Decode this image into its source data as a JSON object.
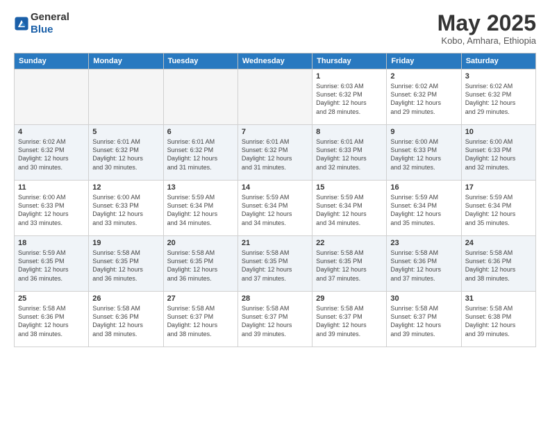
{
  "header": {
    "logo_general": "General",
    "logo_blue": "Blue",
    "month_title": "May 2025",
    "location": "Kobo, Amhara, Ethiopia"
  },
  "days_of_week": [
    "Sunday",
    "Monday",
    "Tuesday",
    "Wednesday",
    "Thursday",
    "Friday",
    "Saturday"
  ],
  "weeks": [
    [
      {
        "day": "",
        "text": ""
      },
      {
        "day": "",
        "text": ""
      },
      {
        "day": "",
        "text": ""
      },
      {
        "day": "",
        "text": ""
      },
      {
        "day": "1",
        "text": "Sunrise: 6:03 AM\nSunset: 6:32 PM\nDaylight: 12 hours\nand 28 minutes."
      },
      {
        "day": "2",
        "text": "Sunrise: 6:02 AM\nSunset: 6:32 PM\nDaylight: 12 hours\nand 29 minutes."
      },
      {
        "day": "3",
        "text": "Sunrise: 6:02 AM\nSunset: 6:32 PM\nDaylight: 12 hours\nand 29 minutes."
      }
    ],
    [
      {
        "day": "4",
        "text": "Sunrise: 6:02 AM\nSunset: 6:32 PM\nDaylight: 12 hours\nand 30 minutes."
      },
      {
        "day": "5",
        "text": "Sunrise: 6:01 AM\nSunset: 6:32 PM\nDaylight: 12 hours\nand 30 minutes."
      },
      {
        "day": "6",
        "text": "Sunrise: 6:01 AM\nSunset: 6:32 PM\nDaylight: 12 hours\nand 31 minutes."
      },
      {
        "day": "7",
        "text": "Sunrise: 6:01 AM\nSunset: 6:32 PM\nDaylight: 12 hours\nand 31 minutes."
      },
      {
        "day": "8",
        "text": "Sunrise: 6:01 AM\nSunset: 6:33 PM\nDaylight: 12 hours\nand 32 minutes."
      },
      {
        "day": "9",
        "text": "Sunrise: 6:00 AM\nSunset: 6:33 PM\nDaylight: 12 hours\nand 32 minutes."
      },
      {
        "day": "10",
        "text": "Sunrise: 6:00 AM\nSunset: 6:33 PM\nDaylight: 12 hours\nand 32 minutes."
      }
    ],
    [
      {
        "day": "11",
        "text": "Sunrise: 6:00 AM\nSunset: 6:33 PM\nDaylight: 12 hours\nand 33 minutes."
      },
      {
        "day": "12",
        "text": "Sunrise: 6:00 AM\nSunset: 6:33 PM\nDaylight: 12 hours\nand 33 minutes."
      },
      {
        "day": "13",
        "text": "Sunrise: 5:59 AM\nSunset: 6:34 PM\nDaylight: 12 hours\nand 34 minutes."
      },
      {
        "day": "14",
        "text": "Sunrise: 5:59 AM\nSunset: 6:34 PM\nDaylight: 12 hours\nand 34 minutes."
      },
      {
        "day": "15",
        "text": "Sunrise: 5:59 AM\nSunset: 6:34 PM\nDaylight: 12 hours\nand 34 minutes."
      },
      {
        "day": "16",
        "text": "Sunrise: 5:59 AM\nSunset: 6:34 PM\nDaylight: 12 hours\nand 35 minutes."
      },
      {
        "day": "17",
        "text": "Sunrise: 5:59 AM\nSunset: 6:34 PM\nDaylight: 12 hours\nand 35 minutes."
      }
    ],
    [
      {
        "day": "18",
        "text": "Sunrise: 5:59 AM\nSunset: 6:35 PM\nDaylight: 12 hours\nand 36 minutes."
      },
      {
        "day": "19",
        "text": "Sunrise: 5:58 AM\nSunset: 6:35 PM\nDaylight: 12 hours\nand 36 minutes."
      },
      {
        "day": "20",
        "text": "Sunrise: 5:58 AM\nSunset: 6:35 PM\nDaylight: 12 hours\nand 36 minutes."
      },
      {
        "day": "21",
        "text": "Sunrise: 5:58 AM\nSunset: 6:35 PM\nDaylight: 12 hours\nand 37 minutes."
      },
      {
        "day": "22",
        "text": "Sunrise: 5:58 AM\nSunset: 6:35 PM\nDaylight: 12 hours\nand 37 minutes."
      },
      {
        "day": "23",
        "text": "Sunrise: 5:58 AM\nSunset: 6:36 PM\nDaylight: 12 hours\nand 37 minutes."
      },
      {
        "day": "24",
        "text": "Sunrise: 5:58 AM\nSunset: 6:36 PM\nDaylight: 12 hours\nand 38 minutes."
      }
    ],
    [
      {
        "day": "25",
        "text": "Sunrise: 5:58 AM\nSunset: 6:36 PM\nDaylight: 12 hours\nand 38 minutes."
      },
      {
        "day": "26",
        "text": "Sunrise: 5:58 AM\nSunset: 6:36 PM\nDaylight: 12 hours\nand 38 minutes."
      },
      {
        "day": "27",
        "text": "Sunrise: 5:58 AM\nSunset: 6:37 PM\nDaylight: 12 hours\nand 38 minutes."
      },
      {
        "day": "28",
        "text": "Sunrise: 5:58 AM\nSunset: 6:37 PM\nDaylight: 12 hours\nand 39 minutes."
      },
      {
        "day": "29",
        "text": "Sunrise: 5:58 AM\nSunset: 6:37 PM\nDaylight: 12 hours\nand 39 minutes."
      },
      {
        "day": "30",
        "text": "Sunrise: 5:58 AM\nSunset: 6:37 PM\nDaylight: 12 hours\nand 39 minutes."
      },
      {
        "day": "31",
        "text": "Sunrise: 5:58 AM\nSunset: 6:38 PM\nDaylight: 12 hours\nand 39 minutes."
      }
    ]
  ]
}
